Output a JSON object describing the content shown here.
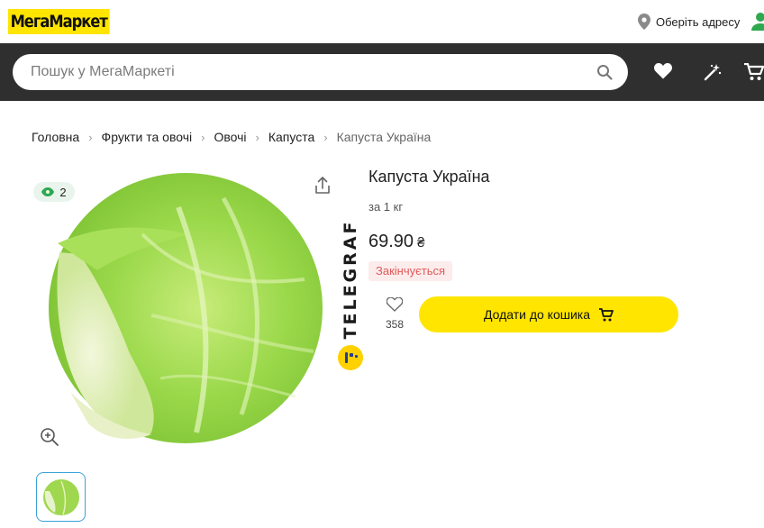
{
  "header": {
    "logo_text": "МегаМаркет",
    "address_label": "Оберіть адресу",
    "brand_color": "#ffe500"
  },
  "search": {
    "placeholder": "Пошук у МегаМаркеті"
  },
  "nav_icons": [
    "heart-icon",
    "magic-wand-icon",
    "cart-icon"
  ],
  "breadcrumb": {
    "items": [
      "Головна",
      "Фрукти та овочі",
      "Овочі",
      "Капуста",
      "Капуста Україна"
    ]
  },
  "gallery": {
    "views_count": "2",
    "watermark": "TELEGRAF"
  },
  "product": {
    "title": "Капуста Україна",
    "unit": "за 1 кг",
    "price": "69.90",
    "currency": "₴",
    "stock_status": "Закінчується",
    "favorites_count": "358",
    "add_to_cart_label": "Додати до кошика"
  }
}
